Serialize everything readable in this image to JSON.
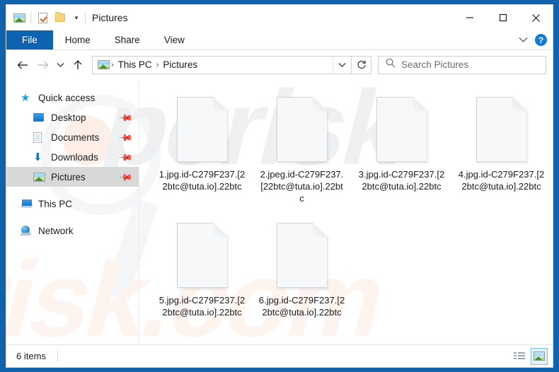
{
  "window": {
    "title": "Pictures",
    "quick_access_toolbar": [
      {
        "name": "pictures-properties-icon",
        "label": "Pictures"
      },
      {
        "name": "properties-icon",
        "label": "Properties"
      },
      {
        "name": "new-folder-icon",
        "label": "New folder"
      },
      {
        "name": "customize-qat-caret",
        "label": "▾"
      }
    ],
    "controls": {
      "minimize": "─",
      "maximize": "□",
      "close": "✕"
    }
  },
  "ribbon": {
    "tabs": [
      {
        "label": "File",
        "selected": true
      },
      {
        "label": "Home",
        "selected": false
      },
      {
        "label": "Share",
        "selected": false
      },
      {
        "label": "View",
        "selected": false
      }
    ],
    "expand_caret": "⌄",
    "help_label": "?"
  },
  "navbar": {
    "back": "←",
    "forward": "→",
    "recent": "⌄",
    "up": "↑",
    "breadcrumb": [
      {
        "label": "This PC"
      },
      {
        "label": "Pictures"
      }
    ],
    "separator": "›",
    "address_caret": "⌄",
    "refresh": "↻"
  },
  "search": {
    "placeholder": "Search Pictures",
    "icon": "search-icon"
  },
  "sidebar": {
    "items": [
      {
        "label": "Quick access",
        "icon": "star-icon",
        "level": 0,
        "pinned": false,
        "selected": false
      },
      {
        "label": "Desktop",
        "icon": "desktop-icon",
        "level": 1,
        "pinned": true,
        "selected": false
      },
      {
        "label": "Documents",
        "icon": "documents-icon",
        "level": 1,
        "pinned": true,
        "selected": false
      },
      {
        "label": "Downloads",
        "icon": "downloads-icon",
        "level": 1,
        "pinned": true,
        "selected": false
      },
      {
        "label": "Pictures",
        "icon": "pictures-icon",
        "level": 1,
        "pinned": true,
        "selected": true
      },
      {
        "label": "This PC",
        "icon": "this-pc-icon",
        "level": 0,
        "pinned": false,
        "selected": false
      },
      {
        "label": "Network",
        "icon": "network-icon",
        "level": 0,
        "pinned": false,
        "selected": false
      }
    ],
    "pin_glyph": "📌"
  },
  "files": [
    {
      "name": "1.jpg.id-C279F237.[22btc@tuta.io].22btc",
      "icon": "generic-file-icon"
    },
    {
      "name": "2.jpeg.id-C279F237.[22btc@tuta.io].22btc",
      "icon": "generic-file-icon"
    },
    {
      "name": "3.jpg.id-C279F237.[22btc@tuta.io].22btc",
      "icon": "generic-file-icon"
    },
    {
      "name": "4.jpg.id-C279F237.[22btc@tuta.io].22btc",
      "icon": "generic-file-icon"
    },
    {
      "name": "5.jpg.id-C279F237.[22btc@tuta.io].22btc",
      "icon": "generic-file-icon"
    },
    {
      "name": "6.jpg.id-C279F237.[22btc@tuta.io].22btc",
      "icon": "generic-file-icon"
    }
  ],
  "statusbar": {
    "item_count": "6 items",
    "views": [
      {
        "name": "details-view-button",
        "active": false
      },
      {
        "name": "large-icons-view-button",
        "active": true
      }
    ]
  },
  "watermark": {
    "line1": "pcrisk",
    "line2": "risk.com"
  },
  "colors": {
    "accent": "#0d63b0",
    "desktop_background": "#1162ad",
    "selection": "#d8d8d8",
    "help_blue": "#0f7bd4"
  }
}
